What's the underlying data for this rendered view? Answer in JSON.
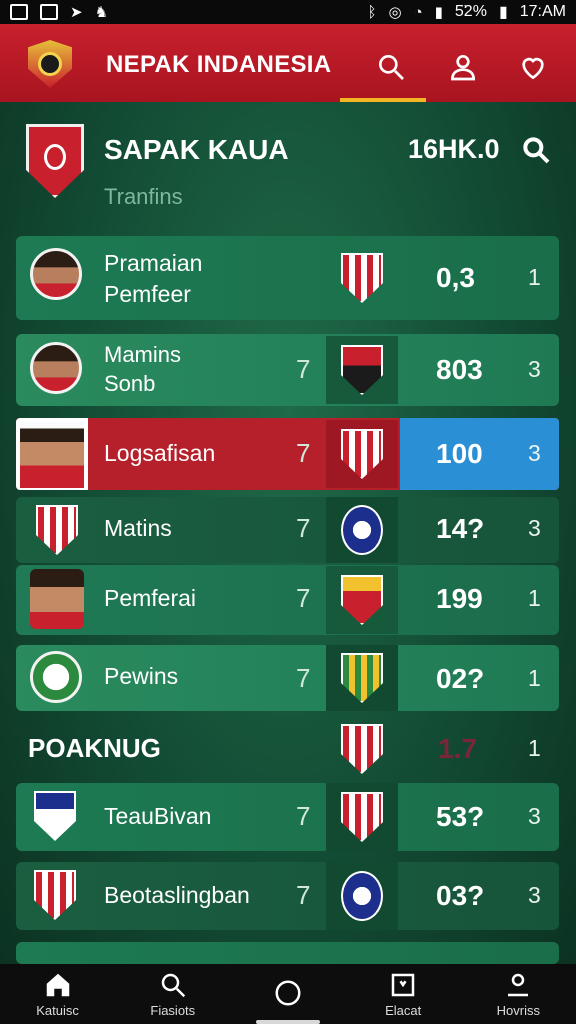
{
  "status_bar": {
    "battery": "5̈2%",
    "time": "17:AM"
  },
  "header": {
    "title": "NEPAK INDANESIA",
    "search_icon": "search-icon",
    "profile_icon": "user-icon",
    "favorites_icon": "heart-icon"
  },
  "league": {
    "title": "SAPAK KAUA",
    "subtitle": "Tranfins",
    "stat": "16HK.0"
  },
  "rows": [
    {
      "name": "Pramaian\nPemfeer",
      "number": "",
      "score": "0,3",
      "rank": "1"
    },
    {
      "name": "Mamins\nSonb",
      "number": "7",
      "score": "803",
      "rank": "3"
    },
    {
      "name": "Logsafisan",
      "number": "7",
      "score": "100",
      "rank": "3"
    },
    {
      "name": "Matins",
      "number": "7",
      "score": "14?",
      "rank": "3"
    },
    {
      "name": "Pemferai",
      "number": "7",
      "score": "199",
      "rank": "1"
    },
    {
      "name": "Pewins",
      "number": "7",
      "score": "02?",
      "rank": "1"
    },
    {
      "name": "TeauBivan",
      "number": "7",
      "score": "53?",
      "rank": "3"
    },
    {
      "name": "Beotaslingban",
      "number": "7",
      "score": "03?",
      "rank": "3"
    }
  ],
  "section": {
    "label": "POAKNUG",
    "score": "1.7",
    "rank": "1"
  },
  "bottom_nav": {
    "home": "Katuisc",
    "search": "Fiasiots",
    "center": "",
    "news": "Elacat",
    "profile": "Hovriss"
  },
  "colors": {
    "header_red": "#c8202d",
    "accent_gold": "#f2b526",
    "highlight_blue": "#2b8fd6"
  }
}
